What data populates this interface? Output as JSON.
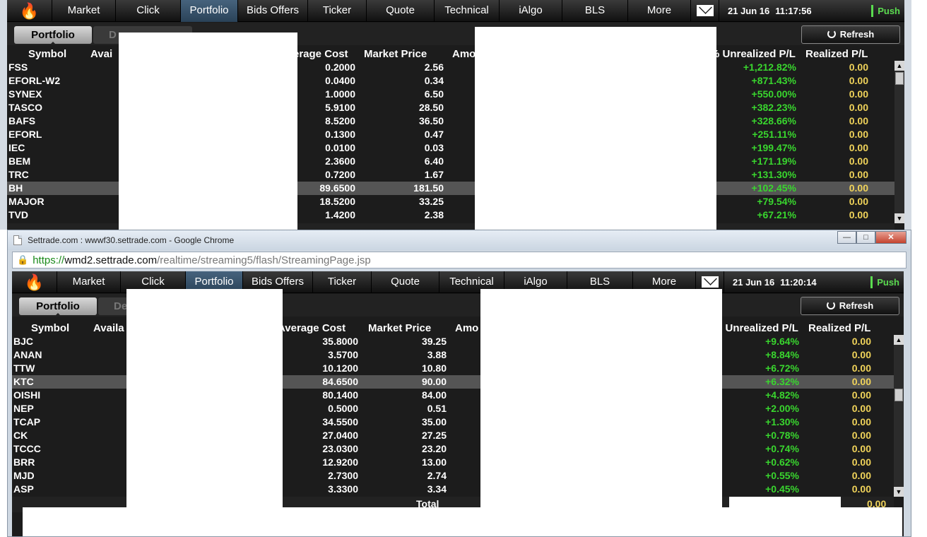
{
  "nav_tabs": [
    "Market",
    "Click",
    "Portfolio",
    "Bids Offers",
    "Ticker",
    "Quote",
    "Technical",
    "iAlgo",
    "BLS",
    "More"
  ],
  "active_tab": "Portfolio",
  "push_label": "Push",
  "refresh_label": "Refresh",
  "portfolio_tab": "Portfolio",
  "columns": {
    "symbol": "Symbol",
    "available": "Avail",
    "average_cost": "Average Cost",
    "market_price": "Market Price",
    "amount": "Amo",
    "unrealized": "% Unrealized P/L",
    "realized": "Realized P/L"
  },
  "window1": {
    "date": "21 Jun 16",
    "time": "11:17:56",
    "deal_tab": "D",
    "avail_header": "Avai",
    "avg_header_visible": "erage Cost",
    "rows": [
      {
        "symbol": "FSS",
        "avg": "0.2000",
        "mkt": "2.56",
        "pct": "+1,212.82%",
        "rpl": "0.00"
      },
      {
        "symbol": "EFORL-W2",
        "avg": "0.0400",
        "mkt": "0.34",
        "pct": "+871.43%",
        "rpl": "0.00"
      },
      {
        "symbol": "SYNEX",
        "avg": "1.0000",
        "mkt": "6.50",
        "pct": "+550.00%",
        "rpl": "0.00"
      },
      {
        "symbol": "TASCO",
        "avg": "5.9100",
        "mkt": "28.50",
        "pct": "+382.23%",
        "rpl": "0.00"
      },
      {
        "symbol": "BAFS",
        "avg": "8.5200",
        "mkt": "36.50",
        "pct": "+328.66%",
        "rpl": "0.00"
      },
      {
        "symbol": "EFORL",
        "avg": "0.1300",
        "mkt": "0.47",
        "pct": "+251.11%",
        "rpl": "0.00"
      },
      {
        "symbol": "IEC",
        "avg": "0.0100",
        "mkt": "0.03",
        "pct": "+199.47%",
        "rpl": "0.00"
      },
      {
        "symbol": "BEM",
        "avg": "2.3600",
        "mkt": "6.40",
        "pct": "+171.19%",
        "rpl": "0.00"
      },
      {
        "symbol": "TRC",
        "avg": "0.7200",
        "mkt": "1.67",
        "pct": "+131.30%",
        "rpl": "0.00"
      },
      {
        "symbol": "BH",
        "avg": "89.6500",
        "mkt": "181.50",
        "pct": "+102.45%",
        "rpl": "0.00",
        "selected": true
      },
      {
        "symbol": "MAJOR",
        "avg": "18.5200",
        "mkt": "33.25",
        "pct": "+79.54%",
        "rpl": "0.00"
      },
      {
        "symbol": "TVD",
        "avg": "1.4200",
        "mkt": "2.38",
        "pct": "+67.21%",
        "rpl": "0.00"
      }
    ]
  },
  "window2": {
    "title": "Settrade.com : wwwf30.settrade.com - Google Chrome",
    "url_scheme": "https://",
    "url_host": "wmd2.settrade.com",
    "url_path": "/realtime/streaming5/flash/StreamingPage.jsp",
    "date": "21 Jun 16",
    "time": "11:20:14",
    "deal_tab": "De",
    "avail_header": "Availa",
    "total_label": "Total",
    "total_rpl": "0.00",
    "rows": [
      {
        "symbol": "BJC",
        "avg": "35.8000",
        "mkt": "39.25",
        "pct": "+9.64%",
        "rpl": "0.00"
      },
      {
        "symbol": "ANAN",
        "avg": "3.5700",
        "mkt": "3.88",
        "pct": "+8.84%",
        "rpl": "0.00"
      },
      {
        "symbol": "TTW",
        "avg": "10.1200",
        "mkt": "10.80",
        "pct": "+6.72%",
        "rpl": "0.00"
      },
      {
        "symbol": "KTC",
        "avg": "84.6500",
        "mkt": "90.00",
        "pct": "+6.32%",
        "rpl": "0.00",
        "selected": true
      },
      {
        "symbol": "OISHI",
        "avg": "80.1400",
        "mkt": "84.00",
        "pct": "+4.82%",
        "rpl": "0.00"
      },
      {
        "symbol": "NEP",
        "avg": "0.5000",
        "mkt": "0.51",
        "pct": "+2.00%",
        "rpl": "0.00"
      },
      {
        "symbol": "TCAP",
        "avg": "34.5500",
        "mkt": "35.00",
        "pct": "+1.30%",
        "rpl": "0.00"
      },
      {
        "symbol": "CK",
        "avg": "27.0400",
        "mkt": "27.25",
        "pct": "+0.78%",
        "rpl": "0.00"
      },
      {
        "symbol": "TCCC",
        "avg": "23.0300",
        "mkt": "23.20",
        "pct": "+0.74%",
        "rpl": "0.00"
      },
      {
        "symbol": "BRR",
        "avg": "12.9200",
        "mkt": "13.00",
        "pct": "+0.62%",
        "rpl": "0.00"
      },
      {
        "symbol": "MJD",
        "avg": "2.7300",
        "mkt": "2.74",
        "pct": "+0.55%",
        "rpl": "0.00"
      },
      {
        "symbol": "ASP",
        "avg": "3.3300",
        "mkt": "3.34",
        "pct": "+0.45%",
        "rpl": "0.00"
      }
    ]
  },
  "colors": {
    "gain": "#39d62e",
    "realized": "#f0d35a",
    "active_tab": "#2a4258",
    "push": "#5adb4f"
  }
}
